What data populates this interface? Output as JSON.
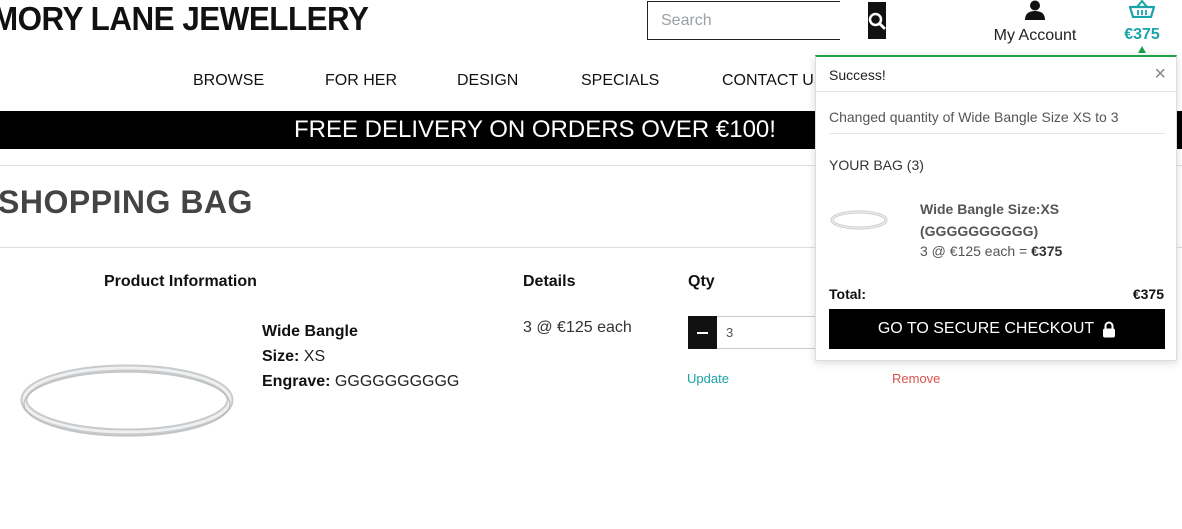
{
  "header": {
    "logo": "MORY LANE JEWELLERY",
    "search_placeholder": "Search",
    "account_label": "My Account",
    "cart_total": "€375"
  },
  "nav": {
    "items": [
      "BROWSE",
      "FOR HER",
      "DESIGN",
      "SPECIALS",
      "CONTACT US"
    ]
  },
  "banner": {
    "text": "FREE DELIVERY ON ORDERS OVER €100!"
  },
  "page": {
    "title": "SHOPPING BAG"
  },
  "table": {
    "headers": {
      "product": "Product Information",
      "details": "Details",
      "qty": "Qty"
    },
    "row": {
      "name": "Wide Bangle",
      "size_label": "Size:",
      "size_value": "XS",
      "engrave_label": "Engrave:",
      "engrave_value": "GGGGGGGGGG",
      "details": "3 @ €125 each",
      "qty_value": "3",
      "update_label": "Update",
      "remove_label": "Remove"
    }
  },
  "popup": {
    "heading": "Success!",
    "close": "×",
    "message": "Changed quantity of Wide Bangle Size XS to 3",
    "bag_label": "YOUR BAG (3)",
    "item_name": "Wide Bangle Size:XS (GGGGGGGGGG)",
    "item_line": "3 @ €125 each = ",
    "item_line_total": "€375",
    "total_label": "Total:",
    "total_value": "€375",
    "checkout_label": "GO TO SECURE CHECKOUT"
  },
  "colors": {
    "accent": "#1aa3a8",
    "success": "#1aa34a",
    "remove": "#d9534f",
    "banner": "#000000"
  },
  "icons": [
    "search-icon",
    "user-icon",
    "basket-icon",
    "lock-icon",
    "minus-icon",
    "close-icon"
  ]
}
